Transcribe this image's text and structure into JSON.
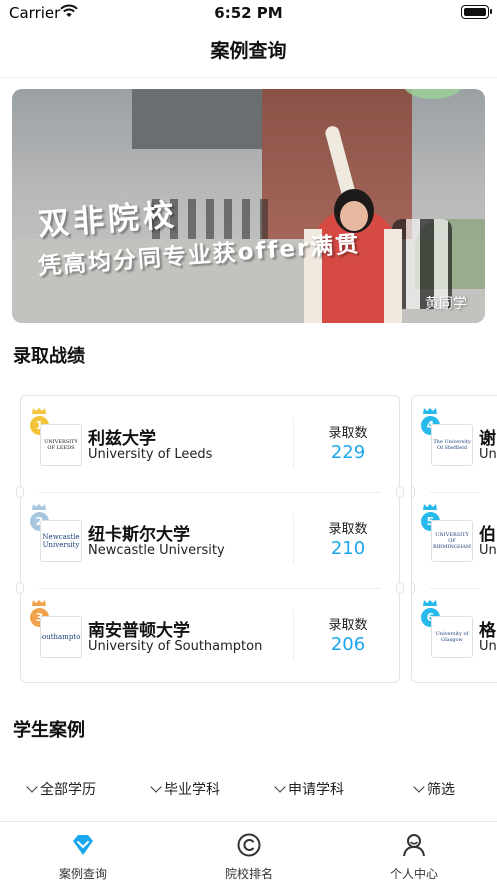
{
  "status_bar": {
    "carrier": "Carrier",
    "time": "6:52 PM"
  },
  "nav": {
    "title": "案例查询"
  },
  "banner": {
    "title": "双非院校",
    "subtitle": "凭高均分同专业获offer满贯",
    "student": "黄同学"
  },
  "admissions": {
    "heading": "录取战绩",
    "count_label": "录取数",
    "cards": [
      {
        "items": [
          {
            "rank": "1",
            "name_cn": "利兹大学",
            "name_en": "University of Leeds",
            "count": "229",
            "logo_text": "UNIVERSITY OF LEEDS"
          },
          {
            "rank": "2",
            "name_cn": "纽卡斯尔大学",
            "name_en": "Newcastle University",
            "count": "210",
            "logo_text": "Newcastle University"
          },
          {
            "rank": "3",
            "name_cn": "南安普顿大学",
            "name_en": "University of Southampton",
            "count": "206",
            "logo_text": "Southampton"
          }
        ]
      },
      {
        "items": [
          {
            "rank": "4",
            "name_cn": "谢",
            "name_en": "Un",
            "logo_text": "The University Of Sheffield"
          },
          {
            "rank": "5",
            "name_cn": "伯",
            "name_en": "Un",
            "logo_text": "UNIVERSITY OF BIRMINGHAM"
          },
          {
            "rank": "6",
            "name_cn": "格",
            "name_en": "Un",
            "logo_text": "University of Glasgow"
          }
        ]
      }
    ]
  },
  "cases": {
    "heading": "学生案例",
    "filters": [
      "全部学历",
      "毕业学科",
      "申请学科",
      "筛选"
    ]
  },
  "tabbar": {
    "tabs": [
      {
        "label": "案例查询",
        "icon": "diamond-icon",
        "active": true
      },
      {
        "label": "院校排名",
        "icon": "ranking-icon",
        "active": false
      },
      {
        "label": "个人中心",
        "icon": "profile-icon",
        "active": false
      }
    ]
  },
  "colors": {
    "accent": "#1ba7ee",
    "rank_gold": "#f3c43a",
    "rank_silver": "#a8c6de",
    "rank_bronze": "#f0a24c",
    "rank_blue": "#28b9ec"
  }
}
